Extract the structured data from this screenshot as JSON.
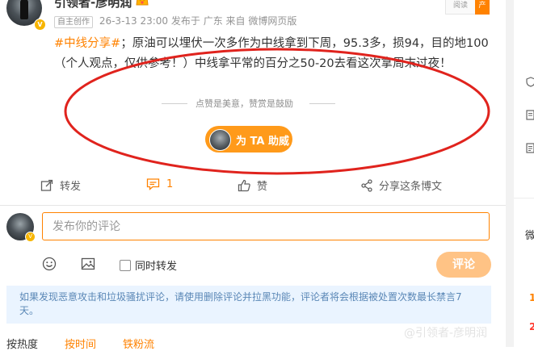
{
  "post": {
    "author": "引领者-彦明润",
    "creator_tag": "自主创作",
    "timestamp": "26-3-13 23:00",
    "location": "发布于 广东",
    "source": "来自 微博网页版",
    "hashtag": "#中线分享#",
    "body": "；原油可以埋伏一次多作为中线拿到下周，95.3多，损94，目的地100（个人观点，仅供参考！）中线拿平常的百分之50-20去看这次拿周末过夜！",
    "reward_text": "点赞是美意，赞赏是鼓励",
    "support_button": "为 TA 助威",
    "read_widget": "阅读",
    "read_widget_tab": "产"
  },
  "actions": {
    "repost": "转发",
    "comment": "评论",
    "comment_count": "1",
    "like": "赞",
    "share": "分享这条博文"
  },
  "composer": {
    "placeholder": "发布你的评论",
    "also_repost": "同时转发",
    "submit": "评论"
  },
  "notice": "如果发现恶意攻击和垃圾骚扰评论，请使用删除评论并拉黑功能，评论者将会根据被处置次数最长禁言7天。",
  "sort_tabs": [
    {
      "label": "按热度",
      "active": false
    },
    {
      "label": "按时间",
      "active": true
    },
    {
      "label": "铁粉流",
      "active": true
    }
  ],
  "watermark": "@引领者-彦明润",
  "right_rail": {
    "heading": "微",
    "numbers": [
      "1",
      "2"
    ]
  },
  "colors": {
    "accent": "#ff8200",
    "annotation": "#e0231d",
    "notice_bg": "#eaf4ff",
    "notice_text": "#5a87b6"
  }
}
